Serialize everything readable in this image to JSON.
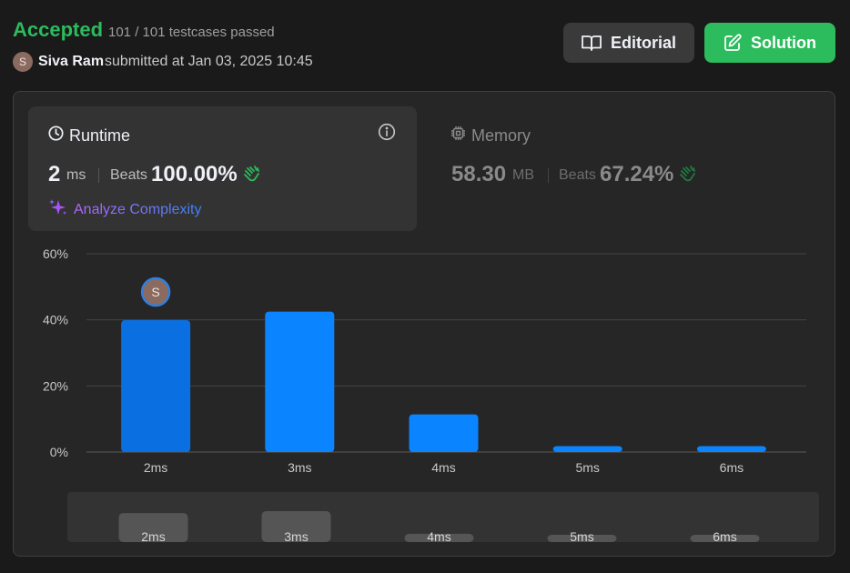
{
  "header": {
    "status": "Accepted",
    "testcases": "101 / 101 testcases passed",
    "avatar_letter": "S",
    "submitter": "Siva Ram",
    "submitted_at": "submitted at Jan 03, 2025 10:45",
    "editorial_label": "Editorial",
    "solution_label": "Solution"
  },
  "runtime": {
    "title": "Runtime",
    "value": "2",
    "unit": "ms",
    "beats_label": "Beats",
    "beats_value": "100.00%",
    "analyze_label": "Analyze Complexity"
  },
  "memory": {
    "title": "Memory",
    "value": "58.30",
    "unit": "MB",
    "beats_label": "Beats",
    "beats_value": "67.24%"
  },
  "colors": {
    "accent_green": "#2cbb5d",
    "bar_blue": "#0a84ff",
    "bar_selected": "#0a6fe0"
  },
  "chart_data": {
    "type": "bar",
    "categories": [
      "2ms",
      "3ms",
      "4ms",
      "5ms",
      "6ms"
    ],
    "values": [
      39.9,
      42.5,
      11.4,
      1.8,
      1.8
    ],
    "yticks": [
      "0%",
      "20%",
      "40%",
      "60%"
    ],
    "ylim": [
      0,
      60
    ],
    "selected_index": 0,
    "marker_letter": "S",
    "overview_categories": [
      "2ms",
      "3ms",
      "4ms",
      "5ms",
      "6ms"
    ],
    "overview_values": [
      39.9,
      42.5,
      11.4,
      1.8,
      1.8
    ]
  }
}
